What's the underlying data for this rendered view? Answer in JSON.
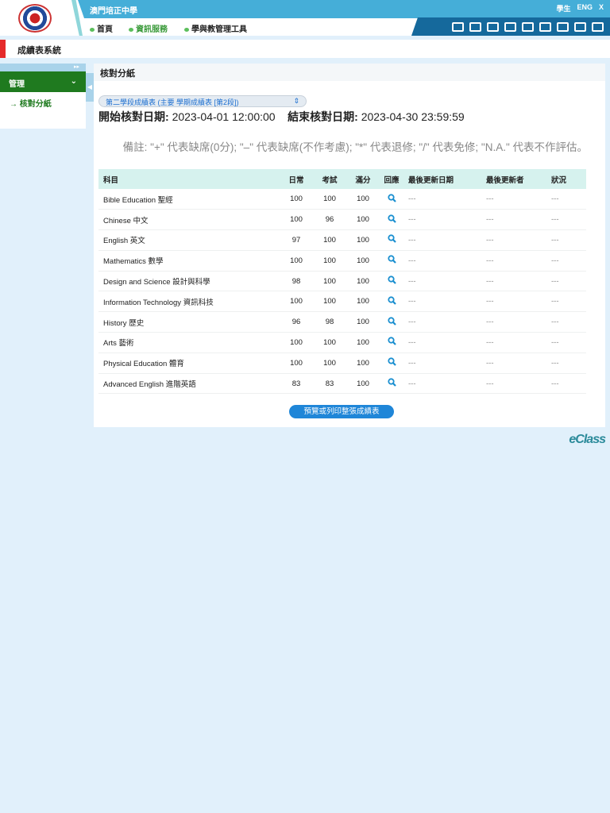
{
  "header": {
    "school": "澳門培正中學",
    "nav": [
      "首頁",
      "資訊服務",
      "學與教管理工具"
    ],
    "toplinks": [
      "學生",
      "ENG",
      "X"
    ]
  },
  "system_title": "成績表系統",
  "sidebar": {
    "section": "管理",
    "items": [
      {
        "label": "核對分紙"
      }
    ]
  },
  "main": {
    "title": "核對分紙",
    "select_value": "第二學段成績表 (主要 學期成績表 [第2段])",
    "start_label": "開始核對日期:",
    "start": "2023-04-01 12:00:00",
    "end_label": "結束核對日期:",
    "end": "2023-04-30 23:59:59",
    "remark": "備註: \"+\" 代表缺席(0分); \"–\" 代表缺席(不作考慮); \"*\" 代表退修; \"/\" 代表免修; \"N.A.\" 代表不作評估。",
    "columns": [
      "科目",
      "日常",
      "考試",
      "滿分",
      "回應",
      "最後更新日期",
      "最後更新者",
      "狀況"
    ],
    "rows": [
      [
        "Bible Education 聖經",
        "100",
        "100",
        "100",
        "---",
        "---",
        "---"
      ],
      [
        "Chinese 中文",
        "100",
        "96",
        "100",
        "---",
        "---",
        "---"
      ],
      [
        "English 英文",
        "97",
        "100",
        "100",
        "---",
        "---",
        "---"
      ],
      [
        "Mathematics 數學",
        "100",
        "100",
        "100",
        "---",
        "---",
        "---"
      ],
      [
        "Design and Science 設計與科學",
        "98",
        "100",
        "100",
        "---",
        "---",
        "---"
      ],
      [
        "Information Technology 資訊科技",
        "100",
        "100",
        "100",
        "---",
        "---",
        "---"
      ],
      [
        "History 歷史",
        "96",
        "98",
        "100",
        "---",
        "---",
        "---"
      ],
      [
        "Arts 藝術",
        "100",
        "100",
        "100",
        "---",
        "---",
        "---"
      ],
      [
        "Physical Education 體育",
        "100",
        "100",
        "100",
        "---",
        "---",
        "---"
      ],
      [
        "Advanced English 進階英語",
        "83",
        "83",
        "100",
        "---",
        "---",
        "---"
      ]
    ],
    "print_button": "預覽或列印整張成績表"
  },
  "footer": {
    "brand_e": "e",
    "brand_rest": "Class"
  }
}
